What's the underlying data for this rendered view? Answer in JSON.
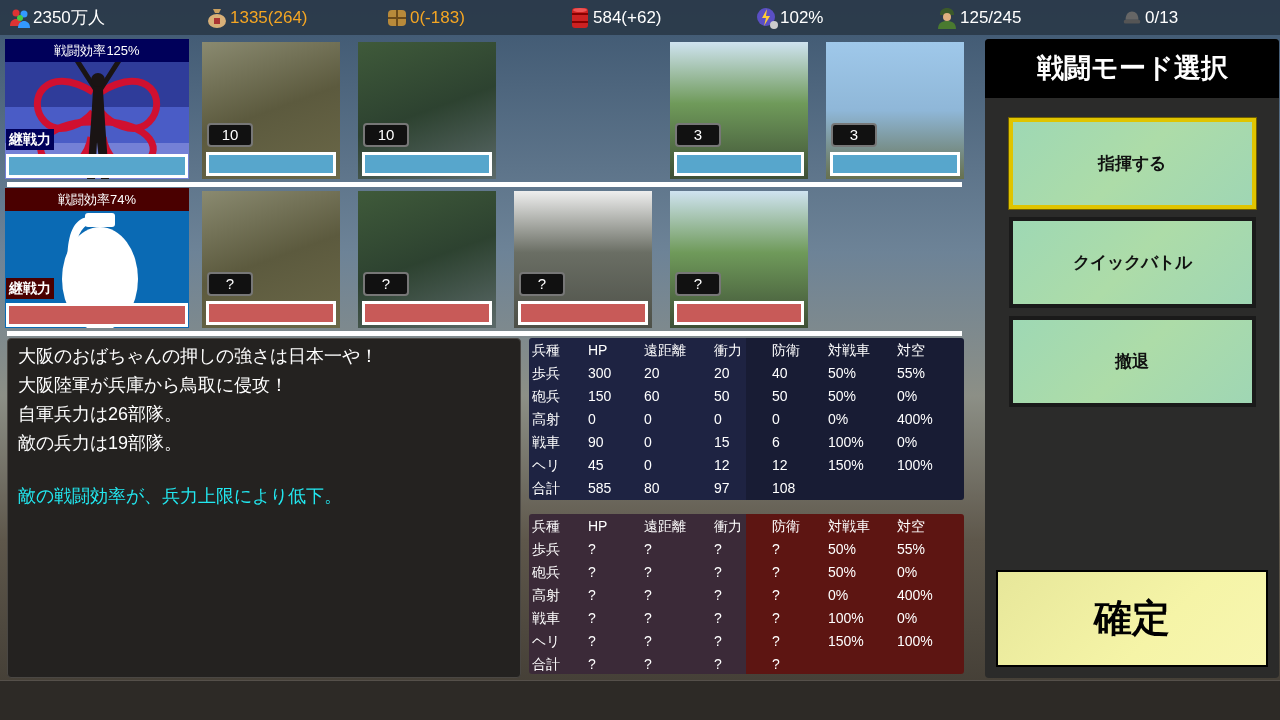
{
  "resources": [
    {
      "text": "2350万人",
      "color": "#ffffff"
    },
    {
      "text": "1335(264)",
      "color": "#f5a623"
    },
    {
      "text": "0(-183)",
      "color": "#f5a623"
    },
    {
      "text": "584(+62)",
      "color": "#ffffff"
    },
    {
      "text": "102%",
      "color": "#ffffff"
    },
    {
      "text": "125/245",
      "color": "#ffffff"
    },
    {
      "text": "0/13",
      "color": "#ffffff"
    }
  ],
  "forces": [
    {
      "efficiency": "戦闘効率125%",
      "stamina_label": "継戦力",
      "level": 1,
      "units": [
        {
          "kind": "unit",
          "count": "10",
          "level": 1
        },
        {
          "kind": "unit",
          "count": "10",
          "level": 1
        },
        {
          "kind": "empty"
        },
        {
          "kind": "unit",
          "count": "3",
          "level": 1
        },
        {
          "kind": "unit",
          "count": "3",
          "level": 1
        }
      ]
    },
    {
      "efficiency": "戦闘効率74%",
      "stamina_label": "継戦力",
      "level": 1,
      "units": [
        {
          "kind": "unit",
          "count": "?",
          "level": 1
        },
        {
          "kind": "unit",
          "count": "?",
          "level": 1
        },
        {
          "kind": "unit",
          "count": "?",
          "level": 1
        },
        {
          "kind": "unit",
          "count": "?",
          "level": 1
        }
      ]
    }
  ],
  "messages": [
    {
      "text": "大阪のおばちゃんの押しの強さは日本一や！",
      "highlight": false
    },
    {
      "text": "大阪陸軍が兵庫から鳥取に侵攻！",
      "highlight": false
    },
    {
      "text": "自軍兵力は26部隊。",
      "highlight": false
    },
    {
      "text": "敵の兵力は19部隊。",
      "highlight": false
    },
    {
      "text": "敵の戦闘効率が、兵力上限により低下。",
      "highlight": true
    }
  ],
  "stats_tables": [
    {
      "columns": [
        "兵種",
        "HP",
        "遠距離",
        "衝力",
        "防衛",
        "対戦車",
        "対空"
      ],
      "rows": [
        [
          "歩兵",
          "300",
          "20",
          "20",
          "40",
          "50%",
          "55%"
        ],
        [
          "砲兵",
          "150",
          "60",
          "50",
          "50",
          "50%",
          "0%"
        ],
        [
          "高射",
          "0",
          "0",
          "0",
          "0",
          "0%",
          "400%"
        ],
        [
          "戦車",
          "90",
          "0",
          "15",
          "6",
          "100%",
          "0%"
        ],
        [
          "ヘリ",
          "45",
          "0",
          "12",
          "12",
          "150%",
          "100%"
        ],
        [
          "合計",
          "585",
          "80",
          "97",
          "108",
          "",
          ""
        ]
      ]
    },
    {
      "columns": [
        "兵種",
        "HP",
        "遠距離",
        "衝力",
        "防衛",
        "対戦車",
        "対空"
      ],
      "rows": [
        [
          "歩兵",
          "?",
          "?",
          "?",
          "?",
          "50%",
          "55%"
        ],
        [
          "砲兵",
          "?",
          "?",
          "?",
          "?",
          "50%",
          "0%"
        ],
        [
          "高射",
          "?",
          "?",
          "?",
          "?",
          "0%",
          "400%"
        ],
        [
          "戦車",
          "?",
          "?",
          "?",
          "?",
          "100%",
          "0%"
        ],
        [
          "ヘリ",
          "?",
          "?",
          "?",
          "?",
          "150%",
          "100%"
        ],
        [
          "合計",
          "?",
          "?",
          "?",
          "?",
          "",
          ""
        ]
      ]
    }
  ],
  "mode_panel": {
    "title": "戦闘モード選択",
    "options": [
      {
        "label": "指揮する",
        "selected": true
      },
      {
        "label": "クイックバトル",
        "selected": false
      },
      {
        "label": "撤退",
        "selected": false
      }
    ],
    "confirm": "確定"
  }
}
